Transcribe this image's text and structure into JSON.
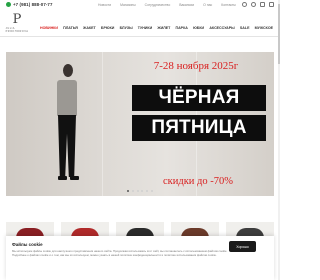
{
  "header": {
    "phone": "+7 (981) 888-07-77",
    "topnav": [
      "Новости",
      "Магазины",
      "Сотрудничество",
      "Вакансии",
      "О нас",
      "Контакты"
    ],
    "icons": [
      "search-icon",
      "user-icon",
      "heart-icon",
      "cart-icon"
    ],
    "logo_mark": "P",
    "logo_text": "JULIA PROKHOROVA"
  },
  "catalog_nav": [
    {
      "label": "НОВИНКИ",
      "highlight": true
    },
    {
      "label": "ПЛАТЬЯ",
      "highlight": false
    },
    {
      "label": "ЖАКЕТ",
      "highlight": false
    },
    {
      "label": "БРЮКИ",
      "highlight": false
    },
    {
      "label": "БЛУЗЫ",
      "highlight": false
    },
    {
      "label": "ТУНИКИ",
      "highlight": false
    },
    {
      "label": "ЖИЛЕТ",
      "highlight": false
    },
    {
      "label": "ПАРКА",
      "highlight": false
    },
    {
      "label": "ЮБКИ",
      "highlight": false
    },
    {
      "label": "АКСЕССУАРЫ",
      "highlight": false
    },
    {
      "label": "SALE",
      "highlight": false
    },
    {
      "label": "МУЖСКОЕ",
      "highlight": false
    }
  ],
  "hero": {
    "date": "7-28 ноября 2025г",
    "title_line1": "ЧЁРНАЯ",
    "title_line2": "ПЯТНИЦА",
    "sale": "скидки до -70%",
    "slides_total": 6,
    "active_slide": 1
  },
  "cookie": {
    "title": "Файлы cookie",
    "text": "Мы используем файлы cookie для наилучшего представления нашего сайта. Продолжая использовать этот сайт, вы соглашаетесь с использованием файлов cookie. Подробнее о файлах cookie и о том, как мы их используем, можно узнать в нашей политике конфиденциальности и политике использования файлов cookie.",
    "accept": "Хорошо"
  },
  "colors": {
    "accent_red": "#d92020",
    "whatsapp": "#25a244",
    "button_dark": "#1a1a1a"
  }
}
